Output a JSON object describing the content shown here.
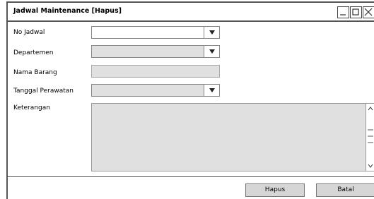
{
  "window": {
    "title": "Jadwal Maintenance [Hapus]",
    "controls": [
      "minimize",
      "maximize",
      "close"
    ]
  },
  "form": {
    "no_jadwal": {
      "label": "No Jadwal",
      "value": ""
    },
    "departemen": {
      "label": "Departemen",
      "value": ""
    },
    "nama_barang": {
      "label": "Nama Barang",
      "value": ""
    },
    "tanggal_perawatan": {
      "label": "Tanggal Perawatan",
      "value": ""
    },
    "keterangan": {
      "label": "Keterangan",
      "value": ""
    }
  },
  "buttons": {
    "hapus": "Hapus",
    "batal": "Batal"
  },
  "colors": {
    "disabled_field": "#e0e0e0",
    "button_bg": "#d6d6d6",
    "border": "#555555"
  }
}
